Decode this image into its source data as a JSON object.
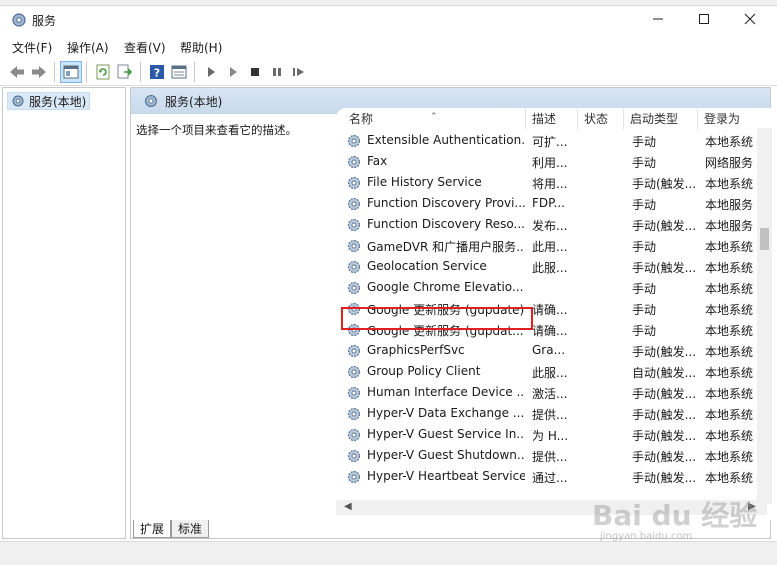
{
  "window": {
    "title": "服务"
  },
  "menu": [
    {
      "label": "文件(F)"
    },
    {
      "label": "操作(A)"
    },
    {
      "label": "查看(V)"
    },
    {
      "label": "帮助(H)"
    }
  ],
  "toolbar_icons": [
    "back-icon",
    "forward-icon",
    "show-tree-icon",
    "refresh-icon",
    "export-icon",
    "help-icon",
    "properties-icon",
    "start-icon",
    "start-alt-icon",
    "stop-icon",
    "pause-icon",
    "restart-icon"
  ],
  "tree": {
    "root_label": "服务(本地)"
  },
  "main": {
    "header": "服务(本地)",
    "description_prompt": "选择一个项目来查看它的描述。"
  },
  "columns": [
    {
      "label": "名称"
    },
    {
      "label": "描述"
    },
    {
      "label": "状态"
    },
    {
      "label": "启动类型"
    },
    {
      "label": "登录为"
    }
  ],
  "services": [
    {
      "name": "Extensible Authentication...",
      "desc": "可扩...",
      "status": "",
      "startup": "手动",
      "logon": "本地系统"
    },
    {
      "name": "Fax",
      "desc": "利用...",
      "status": "",
      "startup": "手动",
      "logon": "网络服务"
    },
    {
      "name": "File History Service",
      "desc": "将用...",
      "status": "",
      "startup": "手动(触发...",
      "logon": "本地系统"
    },
    {
      "name": "Function Discovery Provi...",
      "desc": "FDP...",
      "status": "",
      "startup": "手动",
      "logon": "本地服务"
    },
    {
      "name": "Function Discovery Reso...",
      "desc": "发布...",
      "status": "",
      "startup": "手动(触发...",
      "logon": "本地服务"
    },
    {
      "name": "GameDVR 和广播用户服务...",
      "desc": "此用...",
      "status": "",
      "startup": "手动",
      "logon": "本地系统"
    },
    {
      "name": "Geolocation Service",
      "desc": "此服...",
      "status": "",
      "startup": "手动(触发...",
      "logon": "本地系统"
    },
    {
      "name": "Google Chrome Elevatio...",
      "desc": "",
      "status": "",
      "startup": "手动",
      "logon": "本地系统"
    },
    {
      "name": "Google 更新服务 (gupdate)",
      "desc": "请确...",
      "status": "",
      "startup": "手动",
      "logon": "本地系统"
    },
    {
      "name": "Google 更新服务 (gupdat...",
      "desc": "请确...",
      "status": "",
      "startup": "手动",
      "logon": "本地系统"
    },
    {
      "name": "GraphicsPerfSvc",
      "desc": "Gra...",
      "status": "",
      "startup": "手动(触发...",
      "logon": "本地系统"
    },
    {
      "name": "Group Policy Client",
      "desc": "此服...",
      "status": "",
      "startup": "自动(触发...",
      "logon": "本地系统"
    },
    {
      "name": "Human Interface Device ...",
      "desc": "激活...",
      "status": "",
      "startup": "手动(触发...",
      "logon": "本地系统"
    },
    {
      "name": "Hyper-V Data Exchange ...",
      "desc": "提供...",
      "status": "",
      "startup": "手动(触发...",
      "logon": "本地系统"
    },
    {
      "name": "Hyper-V Guest Service In...",
      "desc": "为 H...",
      "status": "",
      "startup": "手动(触发...",
      "logon": "本地系统"
    },
    {
      "name": "Hyper-V Guest Shutdown...",
      "desc": "提供...",
      "status": "",
      "startup": "手动(触发...",
      "logon": "本地系统"
    },
    {
      "name": "Hyper-V Heartbeat Service",
      "desc": "通过...",
      "status": "",
      "startup": "手动(触发...",
      "logon": "本地系统"
    }
  ],
  "highlighted_service": "Google 更新服务 (gupdate)",
  "tabs": [
    {
      "label": "扩展"
    },
    {
      "label": "标准"
    }
  ],
  "watermark": {
    "text": "Bai du 经验",
    "sub": "jingyan.baidu.com"
  },
  "colors": {
    "highlight_border": "#e02020",
    "header_bg": "#d9e6f4",
    "selected_tree": "#d9e9f8"
  }
}
